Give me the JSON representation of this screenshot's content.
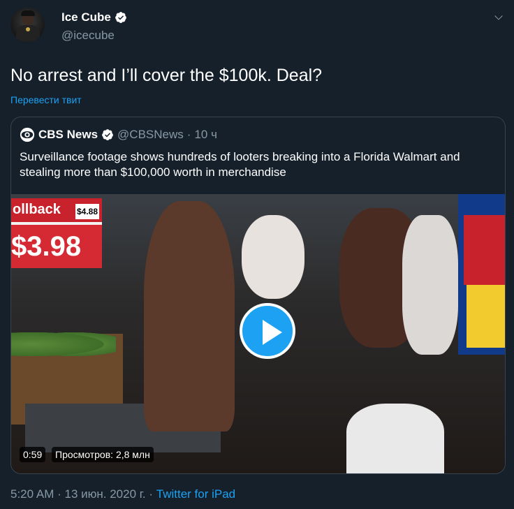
{
  "author": {
    "name": "Ice Cube",
    "handle": "@icecube",
    "avatar_icon": "profile-photo",
    "verified_icon": "verified-badge-icon"
  },
  "tweet": {
    "text": "No arrest and I’ll cover the $100k. Deal?",
    "translate_label": "Перевести твит"
  },
  "quoted": {
    "name": "CBS News",
    "handle": "@CBSNews",
    "separator": "·",
    "time": "10 ч",
    "text": "Surveillance footage shows hundreds of looters breaking into a Florida Walmart and stealing more than $100,000 worth in merchandise",
    "video": {
      "duration": "0:59",
      "views": "Просмотров: 2,8 млн",
      "sign_text": "ollback",
      "sign_small": "$4.88",
      "sign_price": "$3.98",
      "play_icon": "play-icon"
    }
  },
  "meta": {
    "time": "5:20 AM",
    "separator1": "·",
    "date": "13 июн. 2020 г.",
    "separator2": "·",
    "source": "Twitter for iPad"
  },
  "colors": {
    "background": "#15202b",
    "accent": "#1da1f2",
    "secondary_text": "#8899a6",
    "border": "#38444d"
  }
}
